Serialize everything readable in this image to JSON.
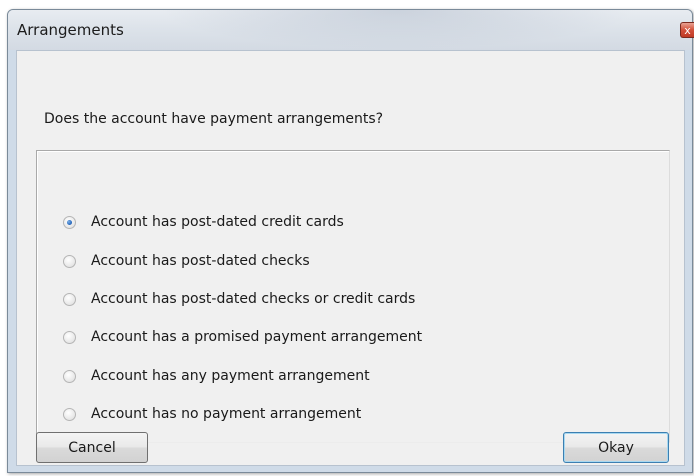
{
  "window": {
    "title": "Arrangements",
    "close_glyph": "x"
  },
  "dialog": {
    "question": "Does the account have payment arrangements?",
    "options": [
      {
        "label": "Account has post-dated credit cards",
        "checked": true
      },
      {
        "label": "Account has post-dated checks",
        "checked": false
      },
      {
        "label": "Account has post-dated checks or credit cards",
        "checked": false
      },
      {
        "label": "Account has a promised payment arrangement",
        "checked": false
      },
      {
        "label": "Account has any payment arrangement",
        "checked": false
      },
      {
        "label": "Account has no payment arrangement",
        "checked": false
      }
    ],
    "cancel_label": "Cancel",
    "okay_label": "Okay"
  },
  "colors": {
    "radio_selected": "#2b6cbf",
    "default_button_border": "#3c7fb1"
  }
}
